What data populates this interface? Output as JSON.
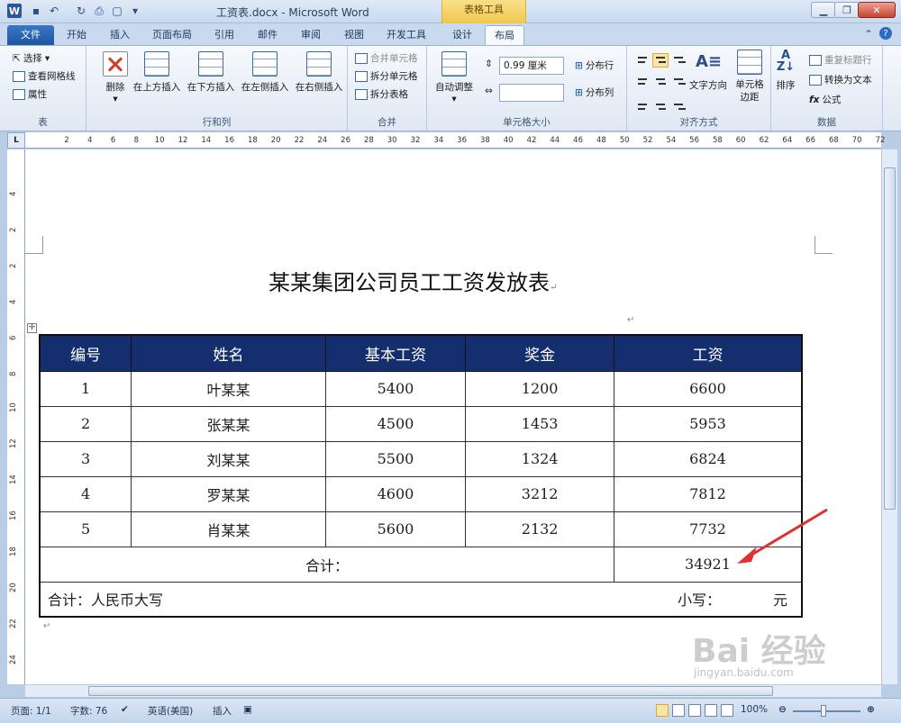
{
  "window": {
    "title": "工资表.docx - Microsoft Word",
    "context_tab": "表格工具"
  },
  "tabs": [
    "文件",
    "开始",
    "插入",
    "页面布局",
    "引用",
    "邮件",
    "审阅",
    "视图",
    "开发工具",
    "设计",
    "布局"
  ],
  "ribbon": {
    "table_group": {
      "label": "表",
      "select": "选择",
      "gridlines": "查看网格线",
      "properties": "属性"
    },
    "rows_cols_group": {
      "label": "行和列",
      "delete": "删除",
      "insert_above": "在上方插入",
      "insert_below": "在下方插入",
      "insert_left": "在左侧插入",
      "insert_right": "在右侧插入"
    },
    "merge_group": {
      "label": "合并",
      "merge_cells": "合并单元格",
      "split_cells": "拆分单元格",
      "split_table": "拆分表格"
    },
    "cell_size_group": {
      "label": "单元格大小",
      "autofit": "自动调整",
      "height_value": "0.99 厘米",
      "distribute_rows": "分布行",
      "distribute_cols": "分布列"
    },
    "alignment_group": {
      "label": "对齐方式",
      "text_direction": "文字方向",
      "cell_margins": "单元格边距"
    },
    "data_group": {
      "label": "数据",
      "sort": "排序",
      "repeat_header": "重复标题行",
      "convert_text": "转换为文本",
      "formula": "公式"
    }
  },
  "ruler": {
    "h_ticks": [
      "2",
      "4",
      "6",
      "8",
      "10",
      "12",
      "14",
      "16",
      "18",
      "20",
      "22",
      "24",
      "26",
      "28",
      "30",
      "32",
      "34",
      "36",
      "38",
      "40",
      "42",
      "44",
      "46",
      "48",
      "50",
      "52",
      "54",
      "56",
      "58",
      "60",
      "62",
      "64",
      "66",
      "68",
      "70",
      "72"
    ],
    "v_ticks": [
      "4",
      "2",
      "2",
      "4",
      "6",
      "8",
      "10",
      "12",
      "14",
      "16",
      "18",
      "20",
      "22",
      "24"
    ]
  },
  "document": {
    "title": "某某集团公司员工工资发放表",
    "table": {
      "headers": [
        "编号",
        "姓名",
        "基本工资",
        "奖金",
        "工资"
      ],
      "rows": [
        [
          "1",
          "叶某某",
          "5400",
          "1200",
          "6600"
        ],
        [
          "2",
          "张某某",
          "4500",
          "1453",
          "5953"
        ],
        [
          "3",
          "刘某某",
          "5500",
          "1324",
          "6824"
        ],
        [
          "4",
          "罗某某",
          "4600",
          "3212",
          "7812"
        ],
        [
          "5",
          "肖某某",
          "5600",
          "2132",
          "7732"
        ]
      ],
      "total_label": "合计：",
      "total_value": "34921",
      "rmb_label": "合计：人民币大写",
      "small_label": "小写：",
      "yuan": "元"
    }
  },
  "status": {
    "page": "页面: 1/1",
    "words": "字数: 76",
    "language": "英语(美国)",
    "mode": "插入",
    "zoom": "100%"
  },
  "watermark": {
    "text": "Bai 经验",
    "sub": "jingyan.baidu.com"
  },
  "colors": {
    "header_bg": "#152e6e",
    "file_tab": "#1d55a3",
    "context": "#f1c74c",
    "arrow": "#e03030"
  }
}
